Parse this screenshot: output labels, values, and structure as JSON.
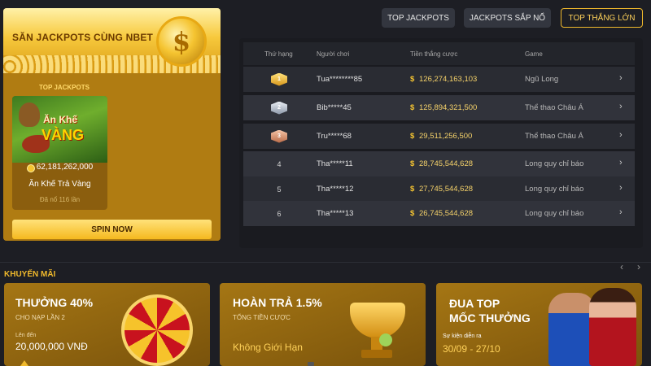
{
  "jackpot_panel": {
    "title": "SĂN JACKPOTS CÙNG NBET",
    "coin_glyph": "$",
    "section_label": "TOP JACKPOTS",
    "game": {
      "logo_line1": "Ăn Khế",
      "logo_line2": "VÀNG",
      "amount": "62,181,262,000",
      "name": "Ăn Khế Trả Vàng",
      "hit_count": "Đã nổ 116 lần"
    },
    "spin_button": "SPIN NOW"
  },
  "tabs": [
    {
      "label": "TOP JACKPOTS",
      "active": false
    },
    {
      "label": "JACKPOTS SẮP NỔ",
      "active": false
    },
    {
      "label": "TOP THẮNG LỚN",
      "active": true
    }
  ],
  "table": {
    "headers": {
      "rank": "Thứ hạng",
      "player": "Người chơi",
      "winnings": "Tiền thắng cược",
      "game": "Game"
    },
    "currency_symbol": "$",
    "rows": [
      {
        "rank": "1",
        "medal": "gold-medal-icon",
        "player": "Tua********85",
        "amount": "126,274,163,103",
        "game": "Ngũ Long"
      },
      {
        "rank": "2",
        "medal": "silver-medal-icon",
        "player": "Bib*****45",
        "amount": "125,894,321,500",
        "game": "Thể thao Châu Á"
      },
      {
        "rank": "3",
        "medal": "bronze-medal-icon",
        "player": "Tru*****68",
        "amount": "29,511,256,500",
        "game": "Thể thao Châu Á"
      },
      {
        "rank": "4",
        "medal": "",
        "player": "Tha*****11",
        "amount": "28,745,544,628",
        "game": "Long quy chỉ báo"
      },
      {
        "rank": "5",
        "medal": "",
        "player": "Tha*****12",
        "amount": "27,745,544,628",
        "game": "Long quy chỉ báo"
      },
      {
        "rank": "6",
        "medal": "",
        "player": "Tha*****13",
        "amount": "26,745,544,628",
        "game": "Long quy chỉ báo"
      }
    ]
  },
  "promotions": {
    "title": "KHUYẾN MÃI",
    "cards": [
      {
        "heading": "THƯỞNG 40%",
        "subheading": "CHO NẠP LẦN 2",
        "small": "Lên đến",
        "big": "20,000,000 VNĐ"
      },
      {
        "heading": "HOÀN TRẢ 1.5%",
        "subheading": "TỔNG TIỀN CƯỢC",
        "small": "",
        "big": "Không Giới Hạn"
      },
      {
        "heading": "ĐUA TOP",
        "heading2": "MỐC THƯỞNG",
        "small": "Sự kiện diễn ra",
        "big": "30/09 - 27/10"
      }
    ]
  },
  "colors": {
    "accent": "#f0b92c",
    "background": "#1d1e24",
    "row": "#2a2c33"
  }
}
